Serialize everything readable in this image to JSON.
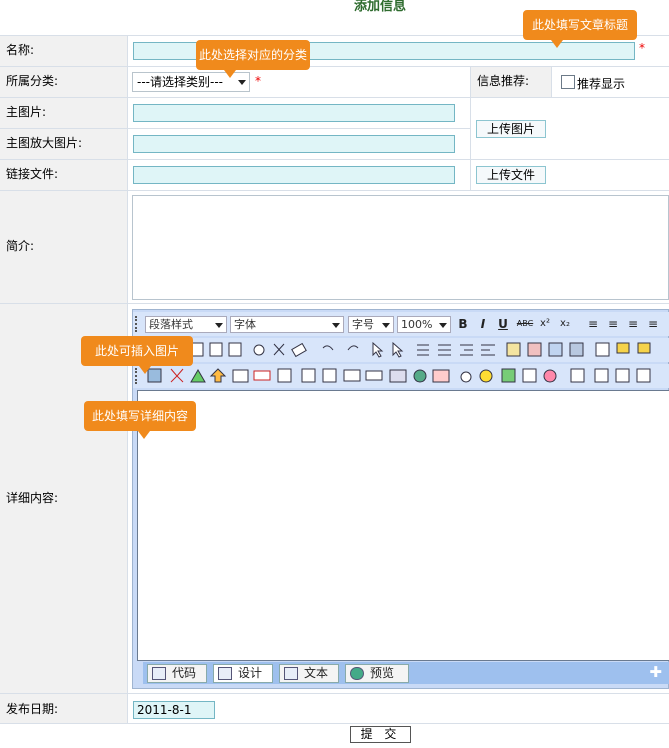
{
  "page": {
    "title": "添加信息"
  },
  "form": {
    "name_label": "名称:",
    "category_label": "所属分类:",
    "category_select": "---请选择类别---",
    "recommend_label": "信息推荐:",
    "recommend_checkbox": "推荐显示",
    "main_image_label": "主图片:",
    "large_image_label": "主图放大图片:",
    "upload_image_button": "上传图片",
    "link_file_label": "链接文件:",
    "upload_file_button": "上传文件",
    "summary_label": "简介:",
    "detail_label": "详细内容:",
    "publish_date_label": "发布日期:",
    "publish_date_value": "2011-8-1",
    "submit_button": "提 交",
    "required_mark": "*"
  },
  "tooltips": {
    "title_tip": "此处填写文章标题",
    "category_tip": "此处选择对应的分类",
    "image_tip": "此处可插入图片",
    "detail_tip": "此处填写详细内容"
  },
  "editor": {
    "paragraph_select": "段落样式",
    "font_select": "字体",
    "size_select": "字号",
    "zoom_select": "100%",
    "tabs": [
      "代码",
      "设计",
      "文本",
      "预览"
    ],
    "icons_row1": [
      "bold-icon",
      "italic-icon",
      "underline-icon",
      "strikethrough-icon",
      "superscript-icon",
      "subscript-icon",
      "align-left-icon",
      "align-center-icon",
      "align-right-icon",
      "justify-icon"
    ],
    "row1_glyphs": [
      "B",
      "I",
      "U",
      "ABC",
      "x²",
      "x₂",
      "≡",
      "≡",
      "≡",
      "≡"
    ]
  },
  "colors": {
    "accent": "#f08a1c",
    "title": "#2e6b2e",
    "input_bg": "#dff5f7",
    "editor_bg": "#c9daf6"
  }
}
